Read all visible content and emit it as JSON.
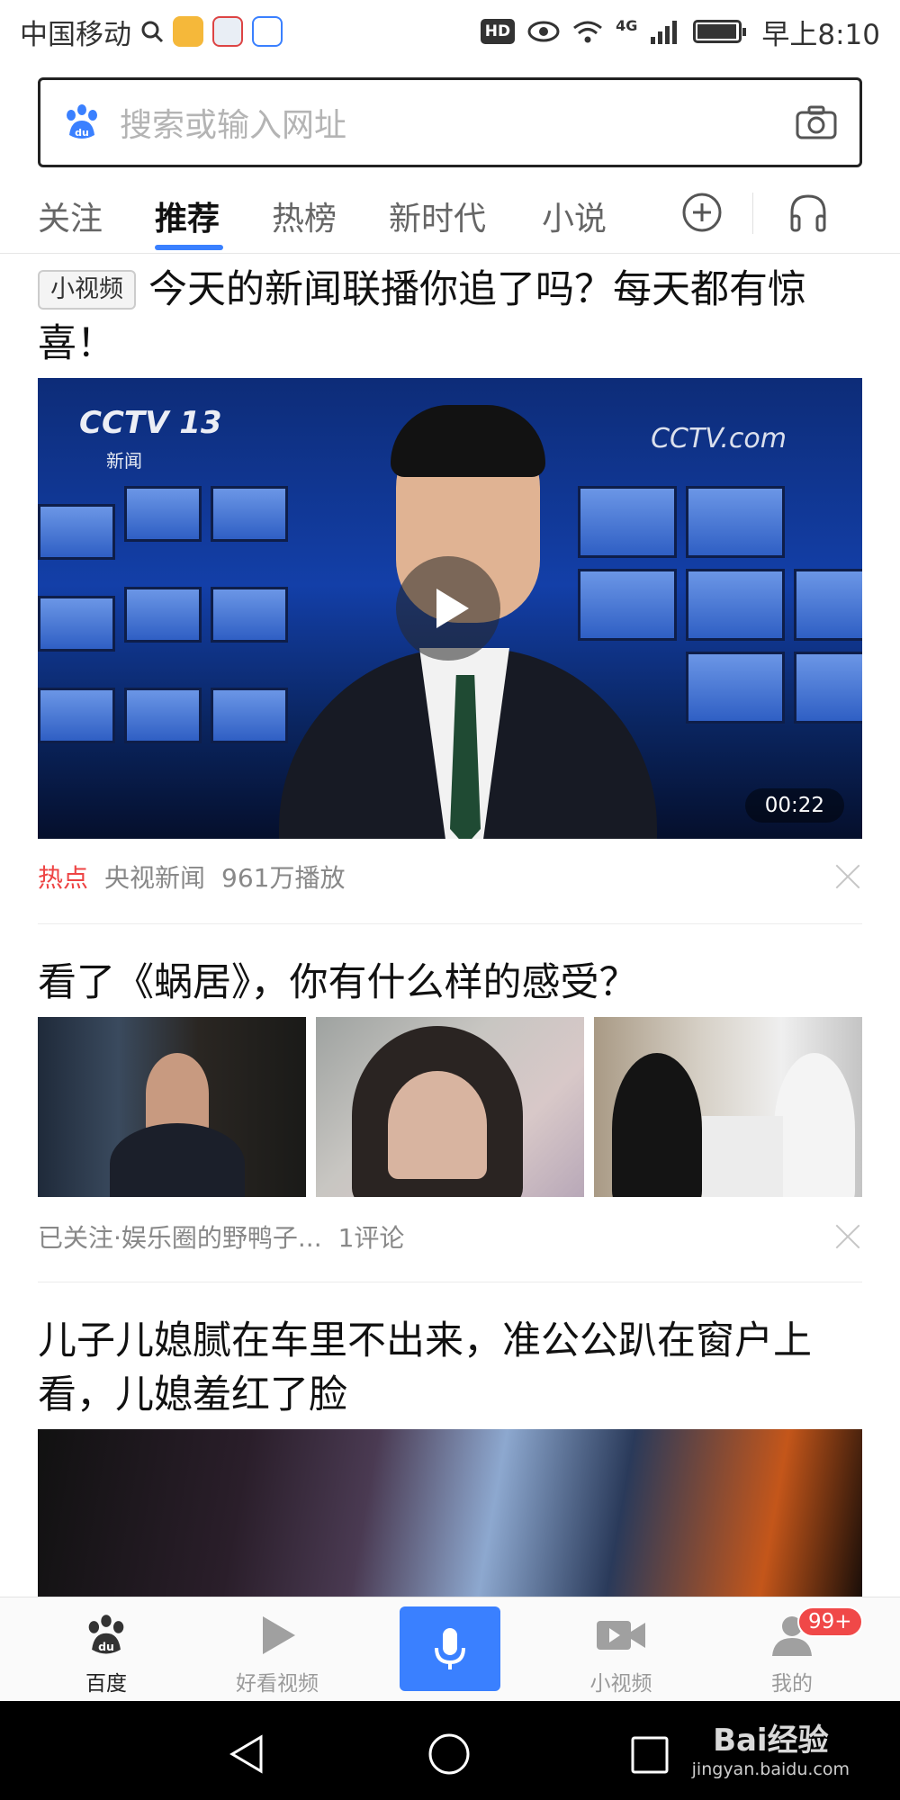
{
  "status_bar": {
    "carrier": "中国移动",
    "network": "4G",
    "hd_label": "HD",
    "time": "早上8:10"
  },
  "search": {
    "placeholder": "搜索或输入网址",
    "icons": [
      "baidu-paw-icon",
      "camera-icon"
    ]
  },
  "tabs": {
    "items": [
      {
        "label": "关注"
      },
      {
        "label": "推荐",
        "active": true
      },
      {
        "label": "热榜"
      },
      {
        "label": "新时代"
      },
      {
        "label": "小说"
      }
    ],
    "icons": [
      "add-circle-icon",
      "headphones-icon"
    ],
    "accent_color": "#3a80ff"
  },
  "feed": [
    {
      "tag": "小视频",
      "title": "今天的新闻联播你追了吗？每天都有惊喜！",
      "thumbnail": {
        "logo_text": "CCTV 13",
        "logo_sub": "新闻",
        "logo_right": "CCTV.com",
        "duration": "00:22"
      },
      "meta": {
        "hot_label": "热点",
        "source": "央视新闻",
        "plays": "961万播放"
      }
    },
    {
      "title": "看了《蜗居》，你有什么样的感受？",
      "meta": {
        "source": "已关注·娱乐圈的野鸭子...",
        "comments": "1评论"
      }
    },
    {
      "title": "儿子儿媳腻在车里不出来，准公公趴在窗户上看，儿媳羞红了脸"
    }
  ],
  "bottom_nav": {
    "items": [
      {
        "label": "百度",
        "icon": "baidu-paw-icon",
        "active": true
      },
      {
        "label": "好看视频",
        "icon": "play-icon"
      },
      {
        "label": "",
        "icon": "microphone-icon"
      },
      {
        "label": "小视频",
        "icon": "video-camera-icon"
      },
      {
        "label": "我的",
        "icon": "user-icon"
      }
    ],
    "badge": "99+",
    "badge_color": "#f04848",
    "mic_color": "#3a80ff"
  },
  "watermark": {
    "main": "Bai经验",
    "sub": "jingyan.baidu.com"
  }
}
